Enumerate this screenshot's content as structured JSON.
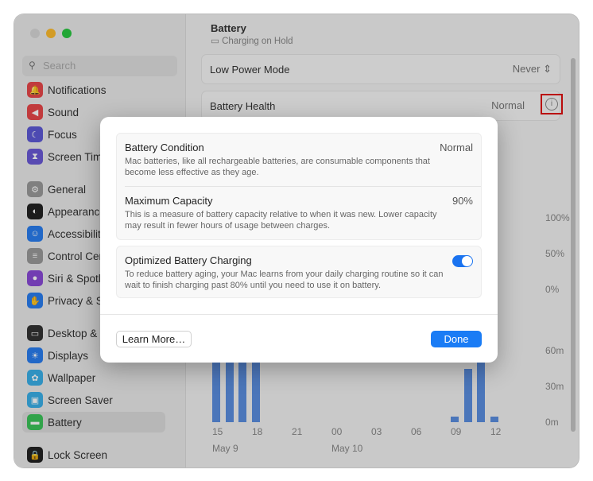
{
  "sidebar": {
    "search_placeholder": "Search",
    "items": [
      {
        "label": "Notifications",
        "icon": "bell-icon",
        "color": "#e8474a"
      },
      {
        "label": "Sound",
        "icon": "speaker-icon",
        "color": "#e8474a"
      },
      {
        "label": "Focus",
        "icon": "moon-icon",
        "color": "#5d5ad6"
      },
      {
        "label": "Screen Time",
        "icon": "hourglass-icon",
        "color": "#6a5ad6"
      },
      {
        "label": "General",
        "icon": "gear-icon",
        "color": "#9a9a9a"
      },
      {
        "label": "Appearance",
        "icon": "appearance-icon",
        "color": "#222222"
      },
      {
        "label": "Accessibility",
        "icon": "accessibility-icon",
        "color": "#2a7ef0"
      },
      {
        "label": "Control Centre",
        "icon": "toggles-icon",
        "color": "#9a9a9a"
      },
      {
        "label": "Siri & Spotlight",
        "icon": "siri-icon",
        "color": "#8a4ad6"
      },
      {
        "label": "Privacy & Security",
        "icon": "hand-icon",
        "color": "#2a7ef0"
      },
      {
        "label": "Desktop & Dock",
        "icon": "dock-icon",
        "color": "#333333"
      },
      {
        "label": "Displays",
        "icon": "sun-icon",
        "color": "#2a7ef0"
      },
      {
        "label": "Wallpaper",
        "icon": "flower-icon",
        "color": "#3ab0e8"
      },
      {
        "label": "Screen Saver",
        "icon": "screensaver-icon",
        "color": "#3ab0e8"
      },
      {
        "label": "Battery",
        "icon": "battery-icon",
        "color": "#3bc45a",
        "selected": true
      },
      {
        "label": "Lock Screen",
        "icon": "lock-icon",
        "color": "#222222"
      }
    ]
  },
  "header": {
    "title": "Battery",
    "status": "Charging on Hold"
  },
  "settings": {
    "low_power_label": "Low Power Mode",
    "low_power_value": "Never",
    "health_label": "Battery Health",
    "health_value": "Normal"
  },
  "chart": {
    "level_ticks": [
      "100%",
      "50%",
      "0%"
    ],
    "usage_ticks": [
      "60m",
      "30m",
      "0m"
    ],
    "hours": [
      "15",
      "18",
      "21",
      "00",
      "03",
      "06",
      "09",
      "12"
    ],
    "dates": [
      "May 9",
      "May 10"
    ],
    "usage_bars": [
      {
        "hour": "15"
      },
      {
        "hour": "16"
      },
      {
        "hour": "17"
      },
      {
        "hour": "18"
      },
      {
        "hour": "09",
        "minutes": 5
      },
      {
        "hour": "10",
        "minutes": 45
      },
      {
        "hour": "11"
      },
      {
        "hour": "12",
        "minutes": 5
      }
    ]
  },
  "dialog": {
    "condition_title": "Battery Condition",
    "condition_value": "Normal",
    "condition_desc": "Mac batteries, like all rechargeable batteries, are consumable components that become less effective as they age.",
    "capacity_title": "Maximum Capacity",
    "capacity_value": "90%",
    "capacity_desc": "This is a measure of battery capacity relative to when it was new. Lower capacity may result in fewer hours of usage between charges.",
    "optimized_title": "Optimized Battery Charging",
    "optimized_on": true,
    "optimized_desc": "To reduce battery aging, your Mac learns from your daily charging routine so it can wait to finish charging past 80% until you need to use it on battery.",
    "learn_more": "Learn More…",
    "done": "Done"
  }
}
